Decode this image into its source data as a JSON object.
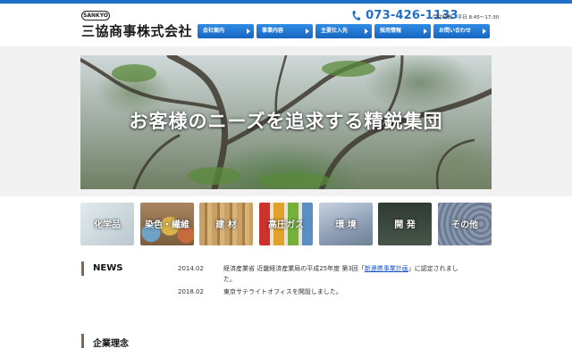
{
  "header": {
    "logo_badge": "SANKYO",
    "company_name": "三協商事株式会社",
    "phone": "073-426-1133",
    "hours_label": "受付時間",
    "hours_value": "平日 8:45～17:30"
  },
  "nav": {
    "items": [
      {
        "label": "会社案内"
      },
      {
        "label": "事業内容"
      },
      {
        "label": "主要仕入先"
      },
      {
        "label": "採用情報"
      },
      {
        "label": "お問い合わせ"
      }
    ]
  },
  "hero": {
    "caption": "お客様のニーズを追求する精鋭集団"
  },
  "categories": [
    {
      "label": "化学品",
      "color": "#c9d6dc"
    },
    {
      "label": "染色・繊維",
      "color": "#b38658"
    },
    {
      "label": "建 材",
      "color": "#c2955a"
    },
    {
      "label": "高圧ガス",
      "color": "#8bbf4a"
    },
    {
      "label": "環 境",
      "color": "#a9b6c9"
    },
    {
      "label": "開 発",
      "color": "#3e4a40"
    },
    {
      "label": "その他",
      "color": "#7d8da6"
    }
  ],
  "news": {
    "title": "NEWS",
    "items": [
      {
        "date": "2014.02",
        "text_before": "経済産業省 近畿経済産業局の平成25年度 第3回「",
        "link": "新連携事業計画",
        "text_after": "」に認定されました。"
      },
      {
        "date": "2018.02",
        "text_before": "東京サテライトオフィスを開設しました。",
        "link": "",
        "text_after": ""
      }
    ]
  },
  "philosophy": {
    "title": "企業理念"
  }
}
